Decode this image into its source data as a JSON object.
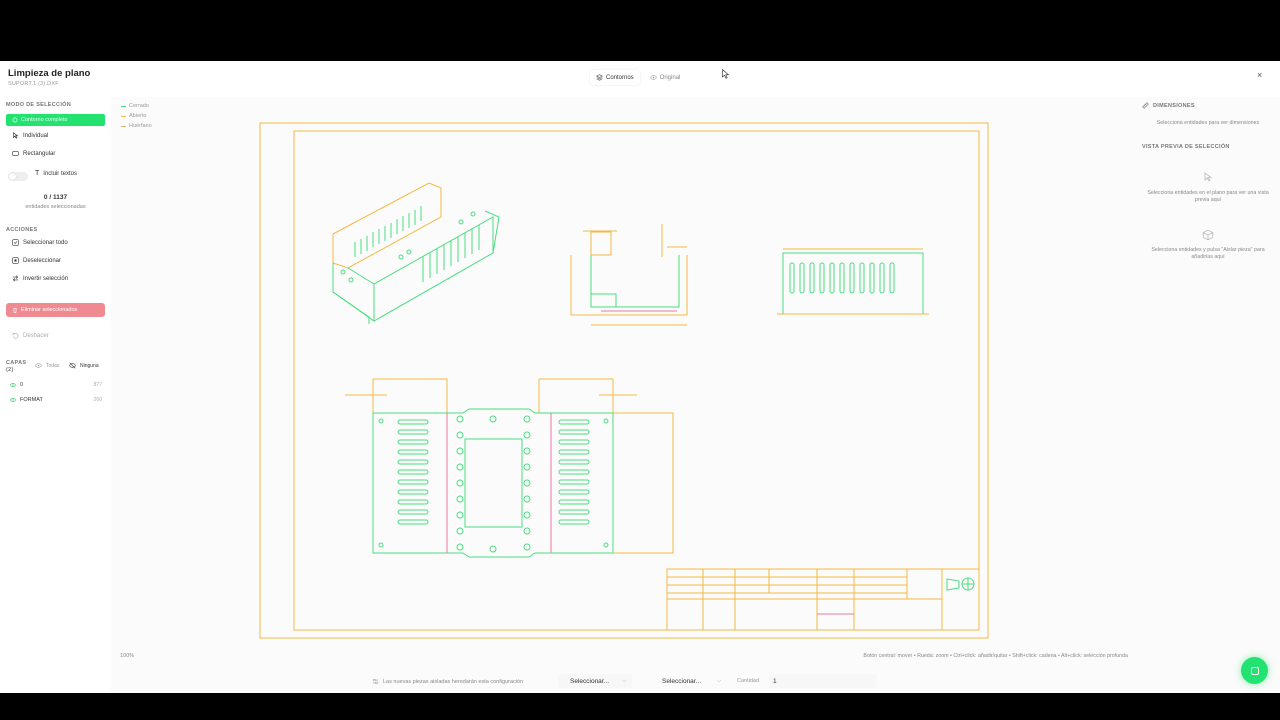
{
  "header": {
    "title": "Limpieza de plano",
    "subtitle": "SUPORT.1 (3).DXF",
    "close": "×"
  },
  "view_toggle": {
    "active": "Contornos",
    "inactive": "Original"
  },
  "left": {
    "mode_title": "MODO DE SELECCIÓN",
    "mode_active": "Contorno completo",
    "mode_individual": "Individual",
    "mode_rect": "Rectangular",
    "include_texts": "Incluir textos",
    "count": "0 / 1137",
    "count_sub": "entidades seleccionadas",
    "actions_title": "ACCIONES",
    "select_all": "Seleccionar todo",
    "deselect": "Deseleccionar",
    "invert": "Invertir selección",
    "delete": "Eliminar seleccionados",
    "undo": "Deshacer",
    "layers_title": "CAPAS (2)",
    "layers_all": "Todas",
    "layers_none": "Ninguna",
    "layers": [
      {
        "name": "0",
        "count": "877",
        "color": "#22c55e"
      },
      {
        "name": "FORMAT",
        "count": "260",
        "color": "#22c55e"
      }
    ]
  },
  "legend": [
    {
      "label": "Cerrado",
      "color": "#4ade80"
    },
    {
      "label": "Abierto",
      "color": "#f5b942"
    },
    {
      "label": "Huérfano",
      "color": "#c9b76b"
    }
  ],
  "canvas": {
    "zoom": "100%",
    "hint": "Botón central: mover • Rueda: zoom • Ctrl+click: añadir/quitar • Shift+click: cadena • Alt+click: selección profunda"
  },
  "right": {
    "dims_title": "DIMENSIONES",
    "dims_text": "Selecciona entidades para ver dimensiones",
    "preview_title": "VISTA PREVIA DE SELECCIÓN",
    "preview_text": "Selecciona entidades en el plano para ver una vista previa aquí",
    "isolate_text": "Selecciona entidades y pulsa \"Aislar pieza\" para añadirlas aquí"
  },
  "bottom": {
    "info": "Las nuevas piezas aisladas heredarán esta configuración",
    "select1": "Seleccionar...",
    "select2": "Seleccionar...",
    "qty_label": "Cantidad",
    "qty_value": "1"
  },
  "colors": {
    "accent": "#22e36f",
    "danger": "#f08a91",
    "closed": "#4ade80",
    "open": "#f5b942",
    "orphan": "#e879a0"
  }
}
